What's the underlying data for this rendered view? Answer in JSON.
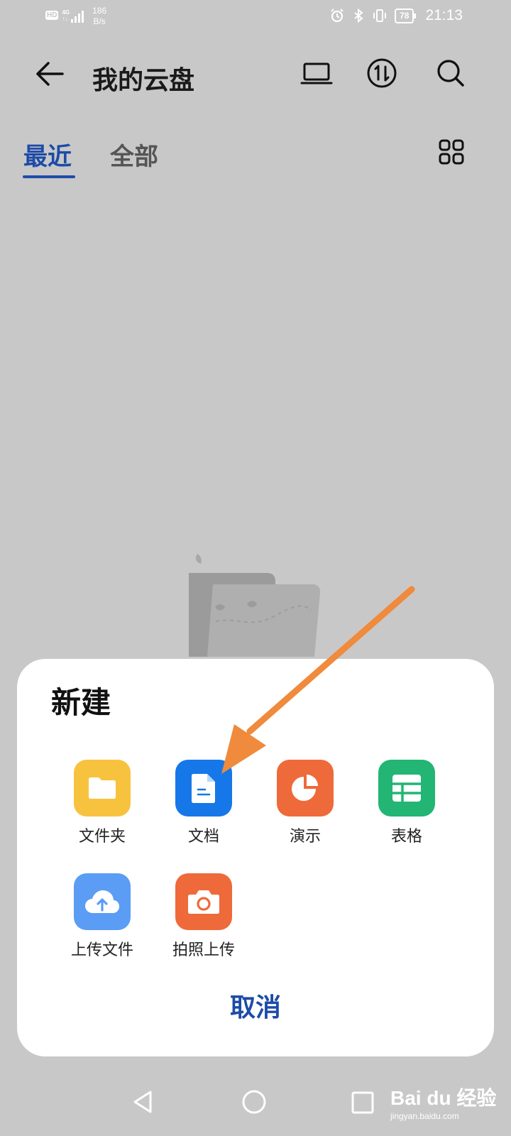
{
  "status_bar": {
    "hd": "HD",
    "network": "4G",
    "network_sub": "↑↓",
    "speed_value": "186",
    "speed_unit": "B/s",
    "battery": "78",
    "time": "21:13",
    "icons": [
      "alarm-icon",
      "bluetooth-icon",
      "vibrate-icon"
    ]
  },
  "header": {
    "title": "我的云盘",
    "icons": [
      "back-arrow-icon",
      "laptop-icon",
      "transfer-icon",
      "search-icon"
    ]
  },
  "tabs": [
    {
      "label": "最近",
      "active": true
    },
    {
      "label": "全部",
      "active": false
    }
  ],
  "view_toggle_icon": "grid-view-icon",
  "sheet": {
    "title": "新建",
    "items": [
      {
        "label": "文件夹",
        "icon": "folder-icon",
        "color": "#f7c33f"
      },
      {
        "label": "文档",
        "icon": "document-icon",
        "color": "#1677e8"
      },
      {
        "label": "演示",
        "icon": "presentation-icon",
        "color": "#ee6a3a"
      },
      {
        "label": "表格",
        "icon": "spreadsheet-icon",
        "color": "#22b573"
      },
      {
        "label": "上传文件",
        "icon": "cloud-upload-icon",
        "color": "#5b9cf5"
      },
      {
        "label": "拍照上传",
        "icon": "camera-icon",
        "color": "#ee6a3a"
      }
    ],
    "cancel": "取消"
  },
  "nav": [
    "back-nav-icon",
    "home-nav-icon",
    "recents-nav-icon"
  ],
  "colors": {
    "accent": "#1d4ba8",
    "overlay": "#c8c8c8",
    "annotation_arrow": "#f08a3c"
  },
  "watermark": {
    "logo": "Bai du 经验",
    "url": "jingyan.baidu.com"
  }
}
